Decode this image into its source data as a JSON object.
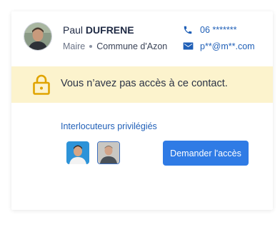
{
  "contact": {
    "first_name": "Paul",
    "last_name": "DUFRENE",
    "role": "Maire",
    "commune": "Commune d'Azon",
    "phone": "06 *******",
    "email": "p**@m**.com"
  },
  "warning": {
    "message": "Vous n’avez pas accès à ce contact."
  },
  "interlocutors": {
    "title": "Interlocuteurs privilégiés",
    "count": 2
  },
  "actions": {
    "request_access_label": "Demander l'accès"
  },
  "colors": {
    "accent": "#2f7be5",
    "link": "#2160b8",
    "warning_bg": "#fcf3cd",
    "warning_icon": "#e0a400"
  },
  "icons": [
    "phone-icon",
    "mail-icon",
    "lock-icon"
  ]
}
